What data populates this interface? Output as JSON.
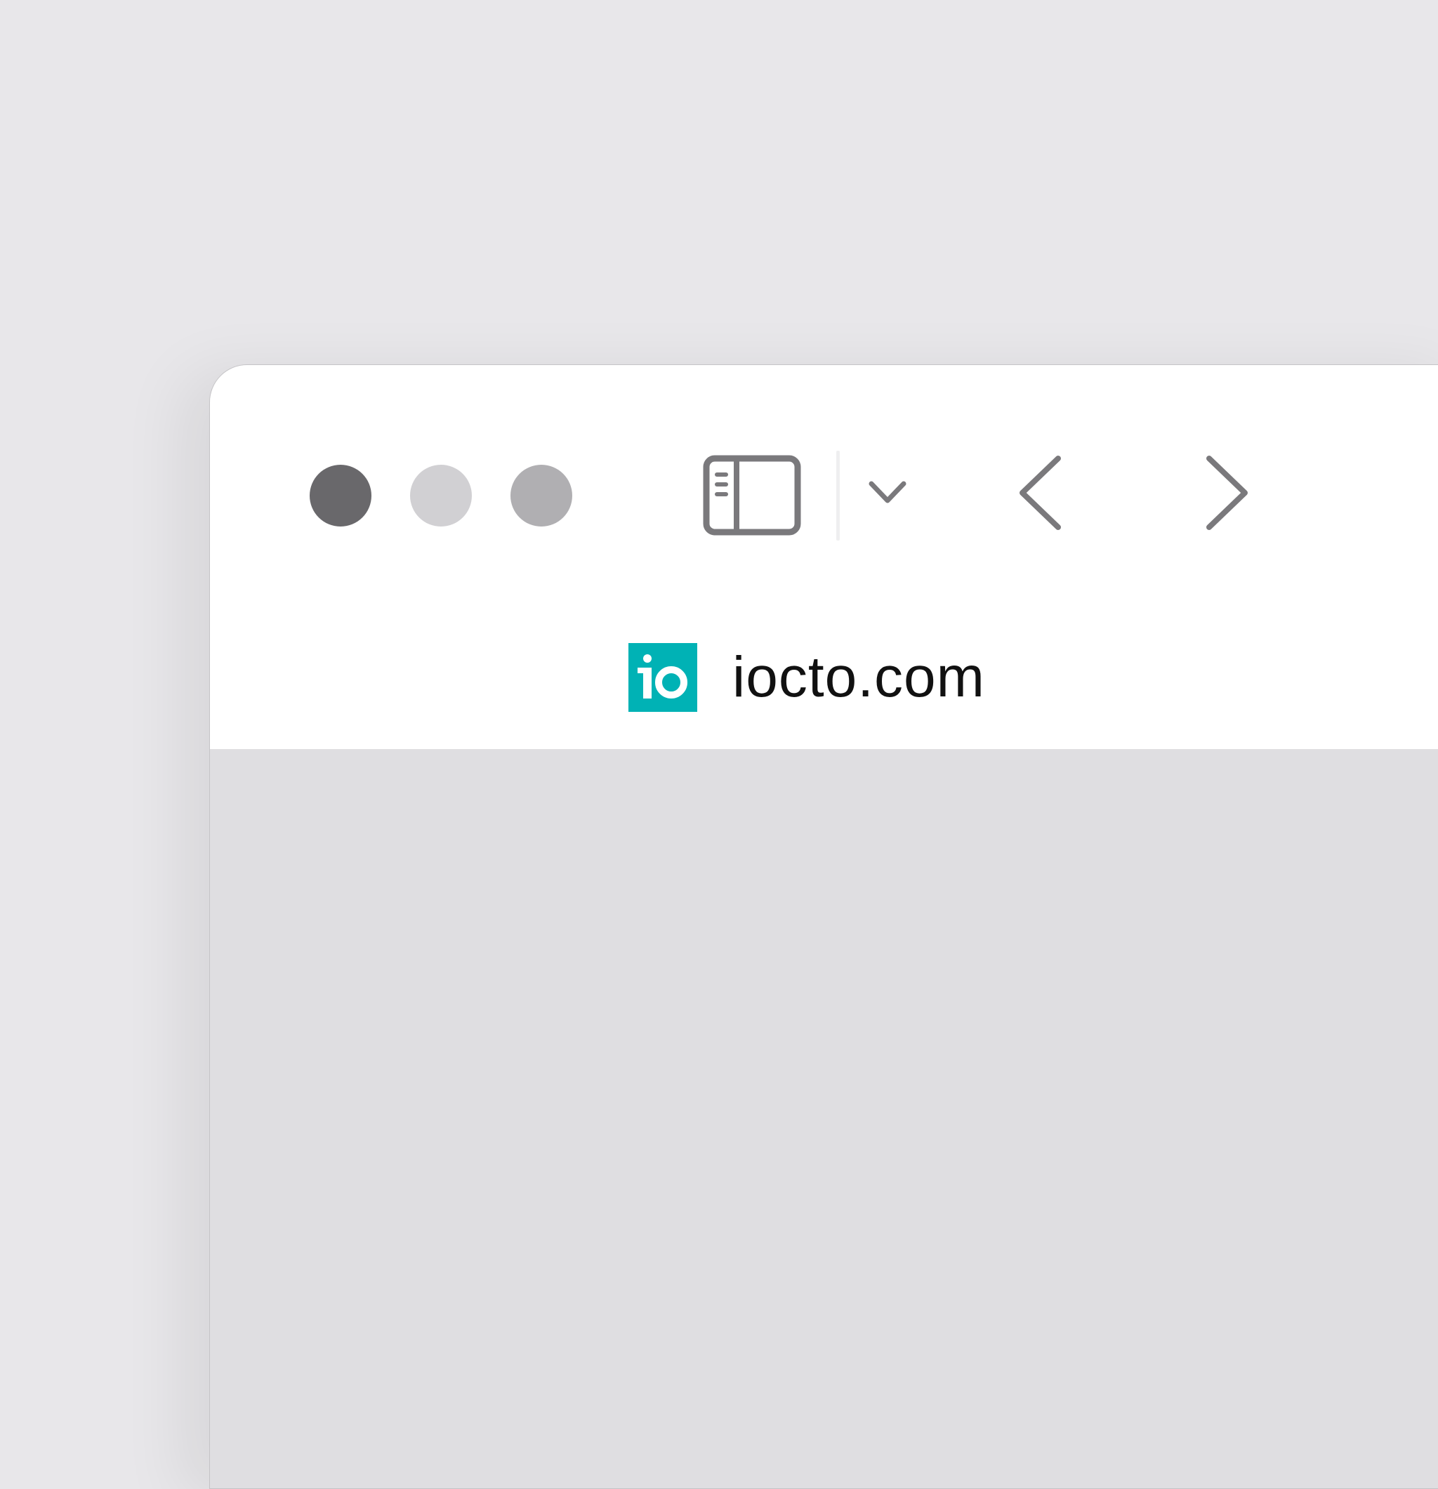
{
  "window": {
    "traffic_lights": [
      {
        "name": "close",
        "color": "#69686b"
      },
      {
        "name": "minimize",
        "color": "#d1d0d3"
      },
      {
        "name": "zoom",
        "color": "#b0afb2"
      }
    ],
    "toolbar": {
      "sidebar_icon": "sidebar-icon",
      "tab_group_icon": "chevron-down-icon",
      "back_icon": "chevron-left-icon",
      "forward_icon": "chevron-right-icon",
      "icon_color": "#7a797c"
    },
    "address_bar": {
      "favicon": "iocto-logo",
      "favicon_color": "#00b2b5",
      "url": "iocto.com"
    },
    "content_background": "#dfdee1"
  }
}
